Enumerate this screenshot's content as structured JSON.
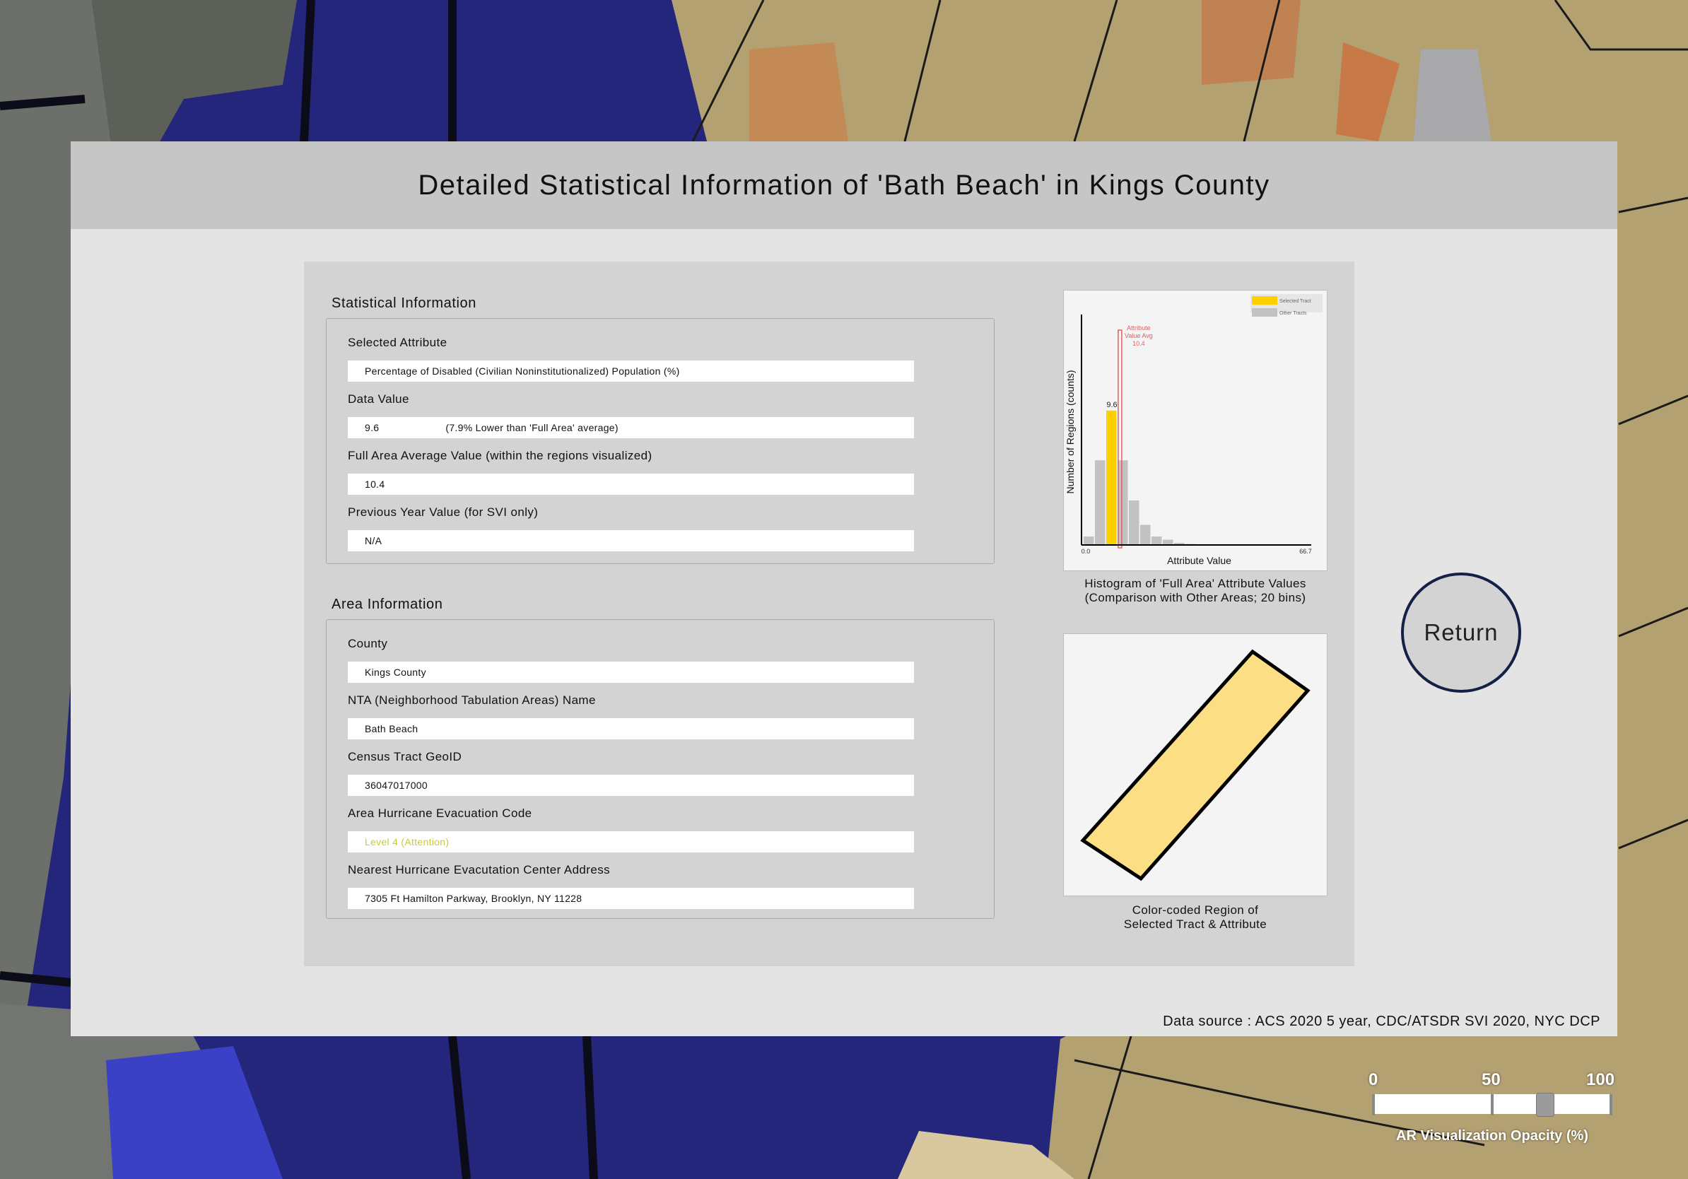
{
  "header": {
    "title": "Detailed Statistical Information of 'Bath Beach' in Kings County"
  },
  "statistical_info": {
    "section_title": "Statistical Information",
    "selected_attribute_label": "Selected Attribute",
    "selected_attribute_value": "Percentage of Disabled (Civilian Noninstitutionalized) Population (%)",
    "data_value_label": "Data Value",
    "data_value": "9.6",
    "data_value_comparison": "(7.9% Lower than 'Full Area' average)",
    "full_area_avg_label": "Full Area Average Value (within the regions visualized)",
    "full_area_avg_value": "10.4",
    "previous_year_label": "Previous Year Value (for SVI only)",
    "previous_year_value": "N/A"
  },
  "area_info": {
    "section_title": "Area Information",
    "county_label": "County",
    "county_value": "Kings County",
    "nta_label": "NTA (Neighborhood Tabulation Areas) Name",
    "nta_value": "Bath Beach",
    "geoid_label": "Census Tract GeoID",
    "geoid_value": "36047017000",
    "evac_code_label": "Area Hurricane Evacuation Code",
    "evac_code_value": "Level 4 (Attention)",
    "evac_center_label": "Nearest Hurricane Evacutation Center Address",
    "evac_center_value": "7305 Ft Hamilton Parkway, Brooklyn, NY 11228"
  },
  "histogram": {
    "caption_line1": "Histogram of 'Full Area' Attribute Values",
    "caption_line2": "(Comparison with Other Areas; 20 bins)"
  },
  "chart_data": {
    "type": "bar",
    "title": "",
    "xlabel": "Attribute Value",
    "ylabel": "Number of Regions (counts)",
    "x_min_label": "0.0",
    "x_max_label": "66.7",
    "bins": 20,
    "series": [
      {
        "name": "Other Tracts",
        "values": [
          8,
          80,
          0,
          80,
          42,
          19,
          8,
          5,
          2,
          1,
          0,
          0,
          0,
          0,
          0,
          0,
          0,
          0,
          0,
          0
        ]
      },
      {
        "name": "Selected Tract",
        "values": [
          0,
          0,
          127,
          0,
          0,
          0,
          0,
          0,
          0,
          0,
          0,
          0,
          0,
          0,
          0,
          0,
          0,
          0,
          0,
          0
        ]
      }
    ],
    "selected_value_label": "9.6",
    "avg_line": {
      "value": 10.4,
      "label_lines": [
        "Attribute",
        "Value Avg",
        "10.4"
      ]
    },
    "legend": [
      {
        "name": "Selected Tract",
        "color": "#ffd000"
      },
      {
        "name": "Other Tracts",
        "color": "#c2c2c2"
      }
    ],
    "legend_position": "top-right",
    "ylim": [
      0,
      215
    ],
    "colors": {
      "selected": "#ffd000",
      "other": "#c2c2c2",
      "avg_line": "#e06060"
    }
  },
  "region_view": {
    "caption_line1": "Color-coded Region of",
    "caption_line2": "Selected Tract & Attribute",
    "fill_color": "#fcdf85"
  },
  "return_button": {
    "label": "Return"
  },
  "data_source": "Data source : ACS 2020 5 year, CDC/ATSDR SVI 2020, NYC DCP",
  "opacity_slider": {
    "tick_labels": [
      "0",
      "50",
      "100"
    ],
    "value": 72,
    "caption": "AR Visualization Opacity (%)"
  }
}
